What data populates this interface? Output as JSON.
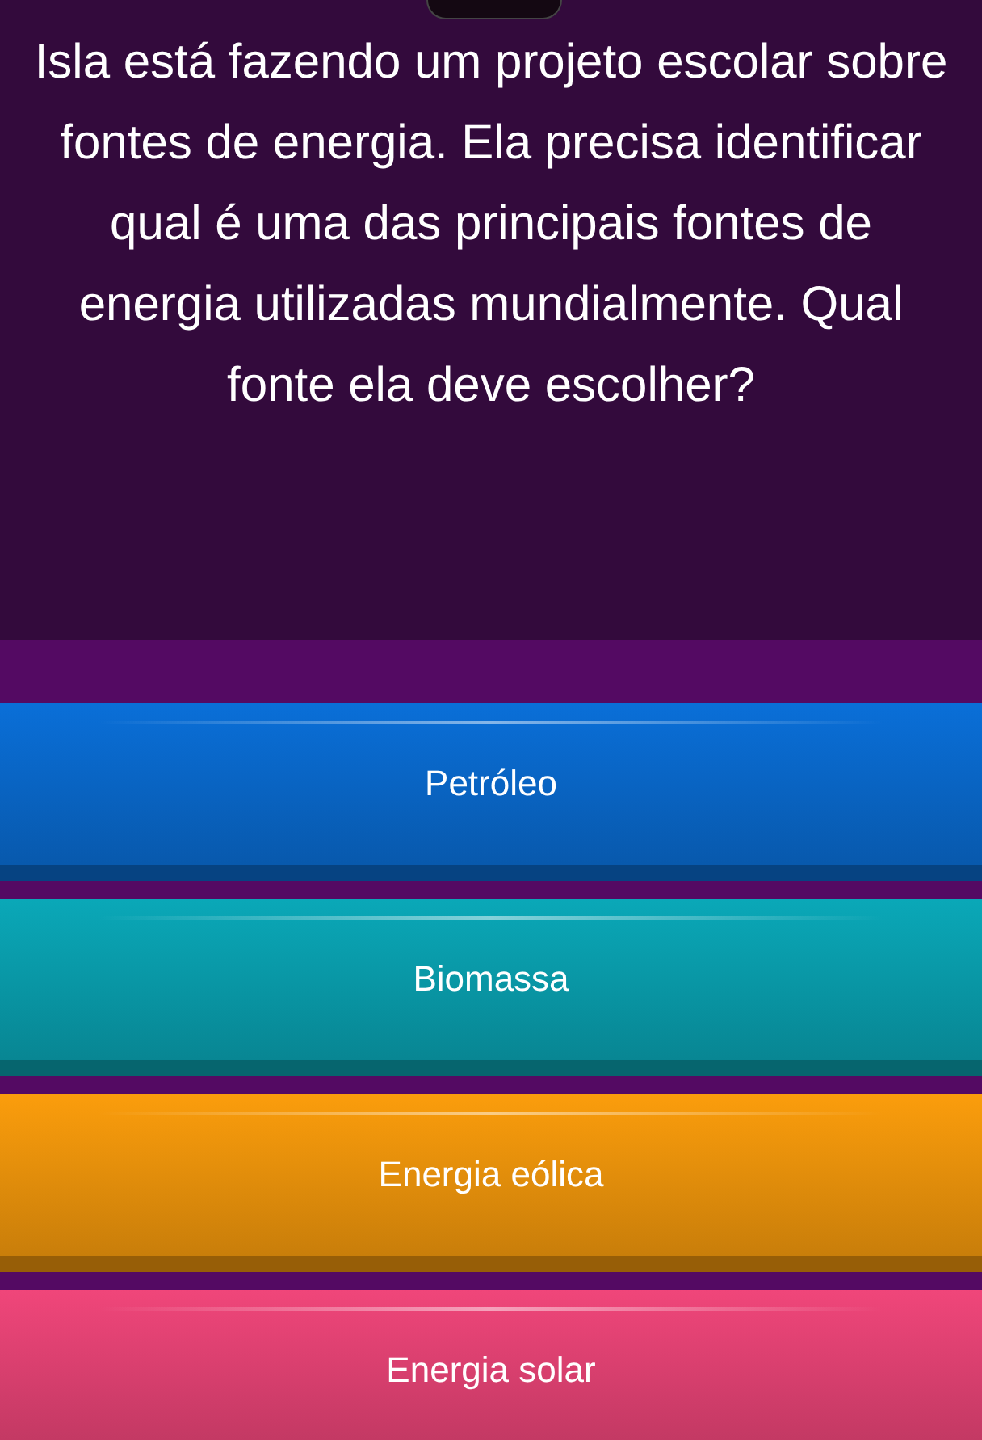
{
  "question": "Isla está fazendo um projeto escolar sobre fontes de energia. Ela precisa identificar qual é uma das principais fontes de energia utilizadas mundialmente. Qual fonte ela deve escolher?",
  "options": [
    {
      "label": "Petróleo",
      "color": "#0a6fd8"
    },
    {
      "label": "Biomassa",
      "color": "#0aa8b8"
    },
    {
      "label": "Energia eólica",
      "color": "#fb9d0c"
    },
    {
      "label": "Energia solar",
      "color": "#f0467a"
    }
  ]
}
